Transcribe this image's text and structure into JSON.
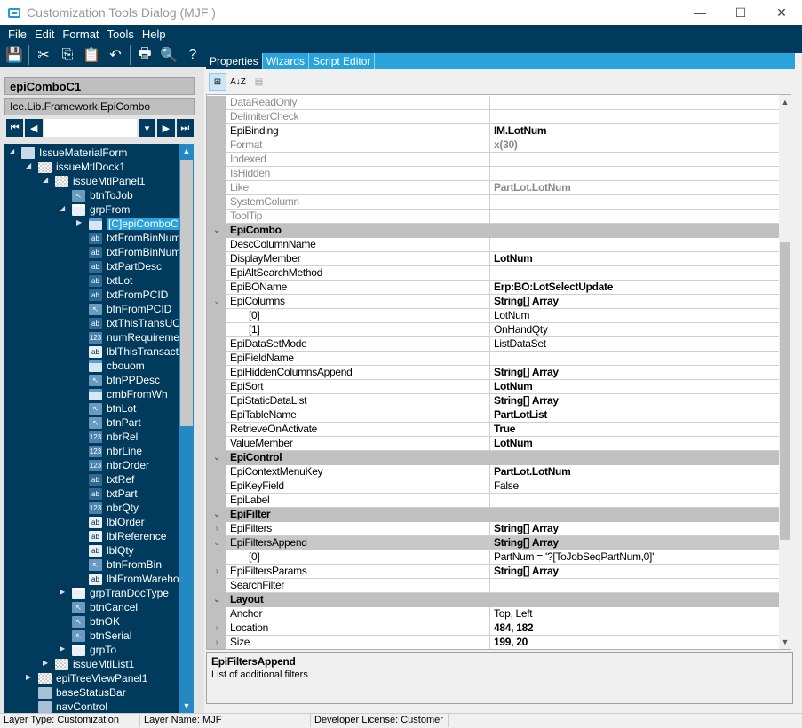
{
  "window": {
    "title": "Customization Tools Dialog  (MJF )",
    "minimize": "—",
    "maximize": "☐",
    "close": "✕"
  },
  "menu": [
    "File",
    "Edit",
    "Format",
    "Tools",
    "Help"
  ],
  "toolbar": [
    {
      "icon": "save-icon",
      "g": "💾"
    },
    {
      "icon": "cut-icon",
      "g": "✂"
    },
    {
      "icon": "copy-icon",
      "g": "⎘"
    },
    {
      "icon": "paste-icon",
      "g": "📋"
    },
    {
      "icon": "undo-icon",
      "g": "↶"
    },
    {
      "icon": "print-icon",
      "g": "🖶"
    },
    {
      "icon": "print-preview-icon",
      "g": "🔍"
    },
    {
      "icon": "help-icon",
      "g": "?"
    }
  ],
  "selected": {
    "name": "epiComboC1",
    "type": "Ice.Lib.Framework.EpiCombo"
  },
  "nav": {
    "first": "⏮",
    "prev": "◀",
    "dropdown": "▾",
    "next": "▶",
    "last": "⏭"
  },
  "tree": [
    {
      "label": "IssueMaterialForm",
      "level": 0,
      "exp": "open",
      "icon": "form"
    },
    {
      "label": "issueMtlDock1",
      "level": 1,
      "exp": "open",
      "icon": "panel"
    },
    {
      "label": "issueMtlPanel1",
      "level": 2,
      "exp": "open",
      "icon": "panel"
    },
    {
      "label": "btnToJob",
      "level": 3,
      "exp": "",
      "icon": "btn"
    },
    {
      "label": "grpFrom",
      "level": 3,
      "exp": "open",
      "icon": "grp"
    },
    {
      "label": "[C]epiComboC1",
      "level": 4,
      "exp": "closed",
      "icon": "combo",
      "selected": true
    },
    {
      "label": "txtFromBinNum",
      "level": 4,
      "exp": "",
      "icon": "txt"
    },
    {
      "label": "txtFromBinNum",
      "level": 4,
      "exp": "",
      "icon": "txt"
    },
    {
      "label": "txtPartDesc",
      "level": 4,
      "exp": "",
      "icon": "txt"
    },
    {
      "label": "txtLot",
      "level": 4,
      "exp": "",
      "icon": "txt"
    },
    {
      "label": "txtFromPCID",
      "level": 4,
      "exp": "",
      "icon": "txt"
    },
    {
      "label": "btnFromPCID",
      "level": 4,
      "exp": "",
      "icon": "btn"
    },
    {
      "label": "txtThisTransUO",
      "level": 4,
      "exp": "",
      "icon": "txt"
    },
    {
      "label": "numRequireme",
      "level": 4,
      "exp": "",
      "icon": "num"
    },
    {
      "label": "lblThisTransacti",
      "level": 4,
      "exp": "",
      "icon": "lbl"
    },
    {
      "label": "cbouom",
      "level": 4,
      "exp": "",
      "icon": "combo"
    },
    {
      "label": "btnPPDesc",
      "level": 4,
      "exp": "",
      "icon": "btn"
    },
    {
      "label": "cmbFromWh",
      "level": 4,
      "exp": "",
      "icon": "combo"
    },
    {
      "label": "btnLot",
      "level": 4,
      "exp": "",
      "icon": "btn"
    },
    {
      "label": "btnPart",
      "level": 4,
      "exp": "",
      "icon": "btn"
    },
    {
      "label": "nbrRel",
      "level": 4,
      "exp": "",
      "icon": "num"
    },
    {
      "label": "nbrLine",
      "level": 4,
      "exp": "",
      "icon": "num"
    },
    {
      "label": "nbrOrder",
      "level": 4,
      "exp": "",
      "icon": "num"
    },
    {
      "label": "txtRef",
      "level": 4,
      "exp": "",
      "icon": "txt"
    },
    {
      "label": "txtPart",
      "level": 4,
      "exp": "",
      "icon": "txt"
    },
    {
      "label": "nbrQty",
      "level": 4,
      "exp": "",
      "icon": "num"
    },
    {
      "label": "lblOrder",
      "level": 4,
      "exp": "",
      "icon": "lbl"
    },
    {
      "label": "lblReference",
      "level": 4,
      "exp": "",
      "icon": "lbl"
    },
    {
      "label": "lblQty",
      "level": 4,
      "exp": "",
      "icon": "lbl"
    },
    {
      "label": "btnFromBin",
      "level": 4,
      "exp": "",
      "icon": "btn"
    },
    {
      "label": "lblFromWareho",
      "level": 4,
      "exp": "",
      "icon": "lbl"
    },
    {
      "label": "grpTranDocType",
      "level": 3,
      "exp": "closed",
      "icon": "grp"
    },
    {
      "label": "btnCancel",
      "level": 3,
      "exp": "",
      "icon": "btn"
    },
    {
      "label": "btnOK",
      "level": 3,
      "exp": "",
      "icon": "btn"
    },
    {
      "label": "btnSerial",
      "level": 3,
      "exp": "",
      "icon": "btn"
    },
    {
      "label": "grpTo",
      "level": 3,
      "exp": "closed",
      "icon": "grp"
    },
    {
      "label": "issueMtlList1",
      "level": 2,
      "exp": "closed",
      "icon": "panel"
    },
    {
      "label": "epiTreeViewPanel1",
      "level": 1,
      "exp": "closed",
      "icon": "panel"
    },
    {
      "label": "baseStatusBar",
      "level": 1,
      "exp": "",
      "icon": "bar"
    },
    {
      "label": "navControl",
      "level": 1,
      "exp": "",
      "icon": "bar"
    }
  ],
  "tabs": [
    {
      "label": "Properties",
      "active": true
    },
    {
      "label": "Wizards"
    },
    {
      "label": "Script Editor"
    }
  ],
  "grid_toolbar": {
    "categorized": "⊞",
    "alphabetical": "A↓Z",
    "property_pages": "▤"
  },
  "properties": [
    {
      "name": "DataReadOnly",
      "value": "",
      "dim": true
    },
    {
      "name": "DelimiterCheck",
      "value": "",
      "dim": true
    },
    {
      "name": "EpiBinding",
      "value": "IM.LotNum",
      "bold": true
    },
    {
      "name": "Format",
      "value": "x(30)",
      "bold": true,
      "dim": true
    },
    {
      "name": "Indexed",
      "value": "",
      "dim": true
    },
    {
      "name": "IsHidden",
      "value": "",
      "dim": true
    },
    {
      "name": "Like",
      "value": "PartLot.LotNum",
      "bold": true,
      "dim": true
    },
    {
      "name": "SystemColumn",
      "value": "",
      "dim": true
    },
    {
      "name": "ToolTip",
      "value": "",
      "dim": true
    },
    {
      "name": "EpiCombo",
      "cat": true,
      "exp": "⌄"
    },
    {
      "name": "DescColumnName",
      "value": ""
    },
    {
      "name": "DisplayMember",
      "value": "LotNum",
      "bold": true
    },
    {
      "name": "EpiAltSearchMethod",
      "value": ""
    },
    {
      "name": "EpiBOName",
      "value": "Erp:BO:LotSelectUpdate",
      "bold": true
    },
    {
      "name": "EpiColumns",
      "value": "String[] Array",
      "bold": true,
      "exp": "⌄"
    },
    {
      "name": "[0]",
      "value": "LotNum",
      "indent": true
    },
    {
      "name": "[1]",
      "value": "OnHandQty",
      "indent": true
    },
    {
      "name": "EpiDataSetMode",
      "value": "ListDataSet"
    },
    {
      "name": "EpiFieldName",
      "value": ""
    },
    {
      "name": "EpiHiddenColumnsAppend",
      "value": "String[] Array",
      "bold": true
    },
    {
      "name": "EpiSort",
      "value": "LotNum",
      "bold": true
    },
    {
      "name": "EpiStaticDataList",
      "value": "String[] Array",
      "bold": true
    },
    {
      "name": "EpiTableName",
      "value": "PartLotList",
      "bold": true
    },
    {
      "name": "RetrieveOnActivate",
      "value": "True",
      "bold": true
    },
    {
      "name": "ValueMember",
      "value": "LotNum",
      "bold": true
    },
    {
      "name": "EpiControl",
      "cat": true,
      "exp": "⌄"
    },
    {
      "name": "EpiContextMenuKey",
      "value": "PartLot.LotNum",
      "bold": true
    },
    {
      "name": "EpiKeyField",
      "value": "False"
    },
    {
      "name": "EpiLabel",
      "value": ""
    },
    {
      "name": "EpiFilter",
      "cat": true,
      "exp": "⌄"
    },
    {
      "name": "EpiFilters",
      "value": "String[] Array",
      "bold": true,
      "exp": "›"
    },
    {
      "name": "EpiFiltersAppend",
      "value": "String[] Array",
      "bold": true,
      "exp": "⌄",
      "highlight": true
    },
    {
      "name": "[0]",
      "value": "PartNum = '?[ToJobSeqPartNum,0]'",
      "indent": true
    },
    {
      "name": "EpiFiltersParams",
      "value": "String[] Array",
      "bold": true,
      "exp": "›"
    },
    {
      "name": "SearchFilter",
      "value": ""
    },
    {
      "name": "Layout",
      "cat": true,
      "exp": "⌄"
    },
    {
      "name": "Anchor",
      "value": "Top, Left"
    },
    {
      "name": "Location",
      "value": "484, 182",
      "bold": true,
      "exp": "›"
    },
    {
      "name": "Size",
      "value": "199, 20",
      "bold": true,
      "exp": "›"
    }
  ],
  "description": {
    "title": "EpiFiltersAppend",
    "text": "List of additional filters"
  },
  "status": [
    "Layer Type:  Customization",
    "Layer Name:  MJF",
    "Developer License:  Customer"
  ]
}
